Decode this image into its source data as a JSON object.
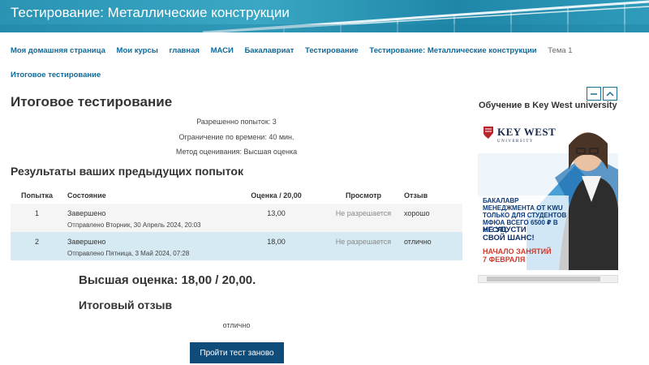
{
  "header": {
    "title": "Тестирование: Металлические конструкции"
  },
  "breadcrumb": [
    "Моя домашняя страница",
    "Мои курсы",
    "главная",
    "МАСИ",
    "Бакалавриат",
    "Тестирование",
    "Тестирование: Металлические конструкции",
    "Тема 1",
    "Итоговое тестирование"
  ],
  "quiz": {
    "title": "Итоговое тестирование",
    "attempts_allowed": "Разрешенно попыток: 3",
    "time_limit": "Ограничение по времени: 40 мин.",
    "grading_method": "Метод оценивания: Высшая оценка"
  },
  "results": {
    "title": "Результаты ваших предыдущих попыток",
    "headers": [
      "Попытка",
      "Состояние",
      "Оценка / 20,00",
      "Просмотр",
      "Отзыв"
    ],
    "rows": [
      {
        "num": "1",
        "state": "Завершено",
        "submitted": "Отправлено Вторник, 30 Апрель 2024, 20:03",
        "grade": "13,00",
        "review": "Не разрешается",
        "feedback": "хорошо"
      },
      {
        "num": "2",
        "state": "Завершено",
        "submitted": "Отправлено Пятница, 3 Май 2024, 07:28",
        "grade": "18,00",
        "review": "Не разрешается",
        "feedback": "отлично"
      }
    ]
  },
  "summary": {
    "best_grade": "Высшая оценка: 18,00 / 20,00.",
    "final_feedback_title": "Итоговый отзыв",
    "final_feedback": "отлично",
    "retry_button": "Пройти тест заново"
  },
  "sidebar": {
    "block_title": "Обучение в Key West university",
    "ad": {
      "logo_main": "KEY WEST",
      "logo_sub": "UNIVERSITY",
      "text": "Бакалавр менеджмента от KWU только для студентов МФЮА всего 6500 ₽ в месяц",
      "cta_line1": "НЕ УПУСТИ",
      "cta_line2": "СВОЙ ШАНС!",
      "start_line1": "Начало занятий",
      "start_line2": "7 февраля"
    }
  },
  "colors": {
    "link": "#0f6a9a",
    "button": "#0f4c7a",
    "row_highlight": "#d6eaf3"
  }
}
